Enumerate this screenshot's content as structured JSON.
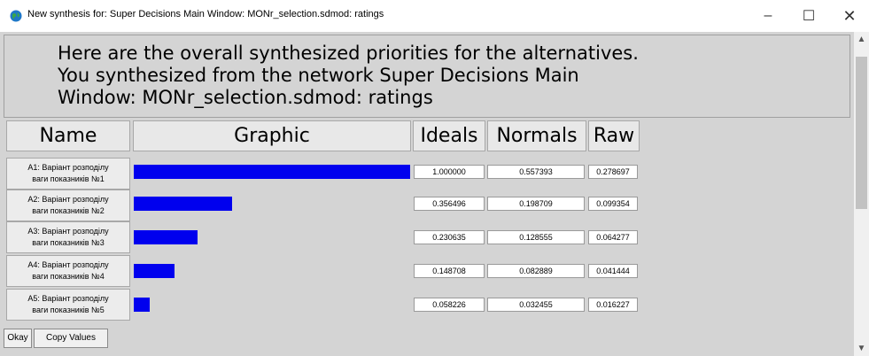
{
  "window": {
    "title": "New synthesis for: Super Decisions Main Window: MONr_selection.sdmod: ratings",
    "minimize_glyph": "–",
    "maximize_glyph": "☐",
    "close_glyph": "✕"
  },
  "header": {
    "line1": "Here are the overall synthesized priorities for the alternatives.",
    "line2": "You synthesized from the network Super Decisions Main",
    "line3": "Window: MONr_selection.sdmod: ratings"
  },
  "columns": {
    "name": "Name",
    "graphic": "Graphic",
    "ideals": "Ideals",
    "normals": "Normals",
    "raw": "Raw"
  },
  "rows": [
    {
      "label_l1": "A1: Варіант розподілу",
      "label_l2": "ваги показників №1",
      "ideal": "1.000000",
      "normal": "0.557393",
      "raw": "0.278697",
      "bar_fraction": 1.0
    },
    {
      "label_l1": "A2: Варіант розподілу",
      "label_l2": "ваги показників №2",
      "ideal": "0.356496",
      "normal": "0.198709",
      "raw": "0.099354",
      "bar_fraction": 0.356496
    },
    {
      "label_l1": "A3: Варіант розподілу",
      "label_l2": "ваги показників №3",
      "ideal": "0.230635",
      "normal": "0.128555",
      "raw": "0.064277",
      "bar_fraction": 0.230635
    },
    {
      "label_l1": "A4: Варіант розподілу",
      "label_l2": "ваги показників №4",
      "ideal": "0.148708",
      "normal": "0.082889",
      "raw": "0.041444",
      "bar_fraction": 0.148708
    },
    {
      "label_l1": "A5: Варіант розподілу",
      "label_l2": "ваги показників №5",
      "ideal": "0.058226",
      "normal": "0.032455",
      "raw": "0.016227",
      "bar_fraction": 0.058226
    }
  ],
  "buttons": {
    "okay": "Okay",
    "copy_values": "Copy Values"
  },
  "colors": {
    "bar": "#0000ee"
  }
}
